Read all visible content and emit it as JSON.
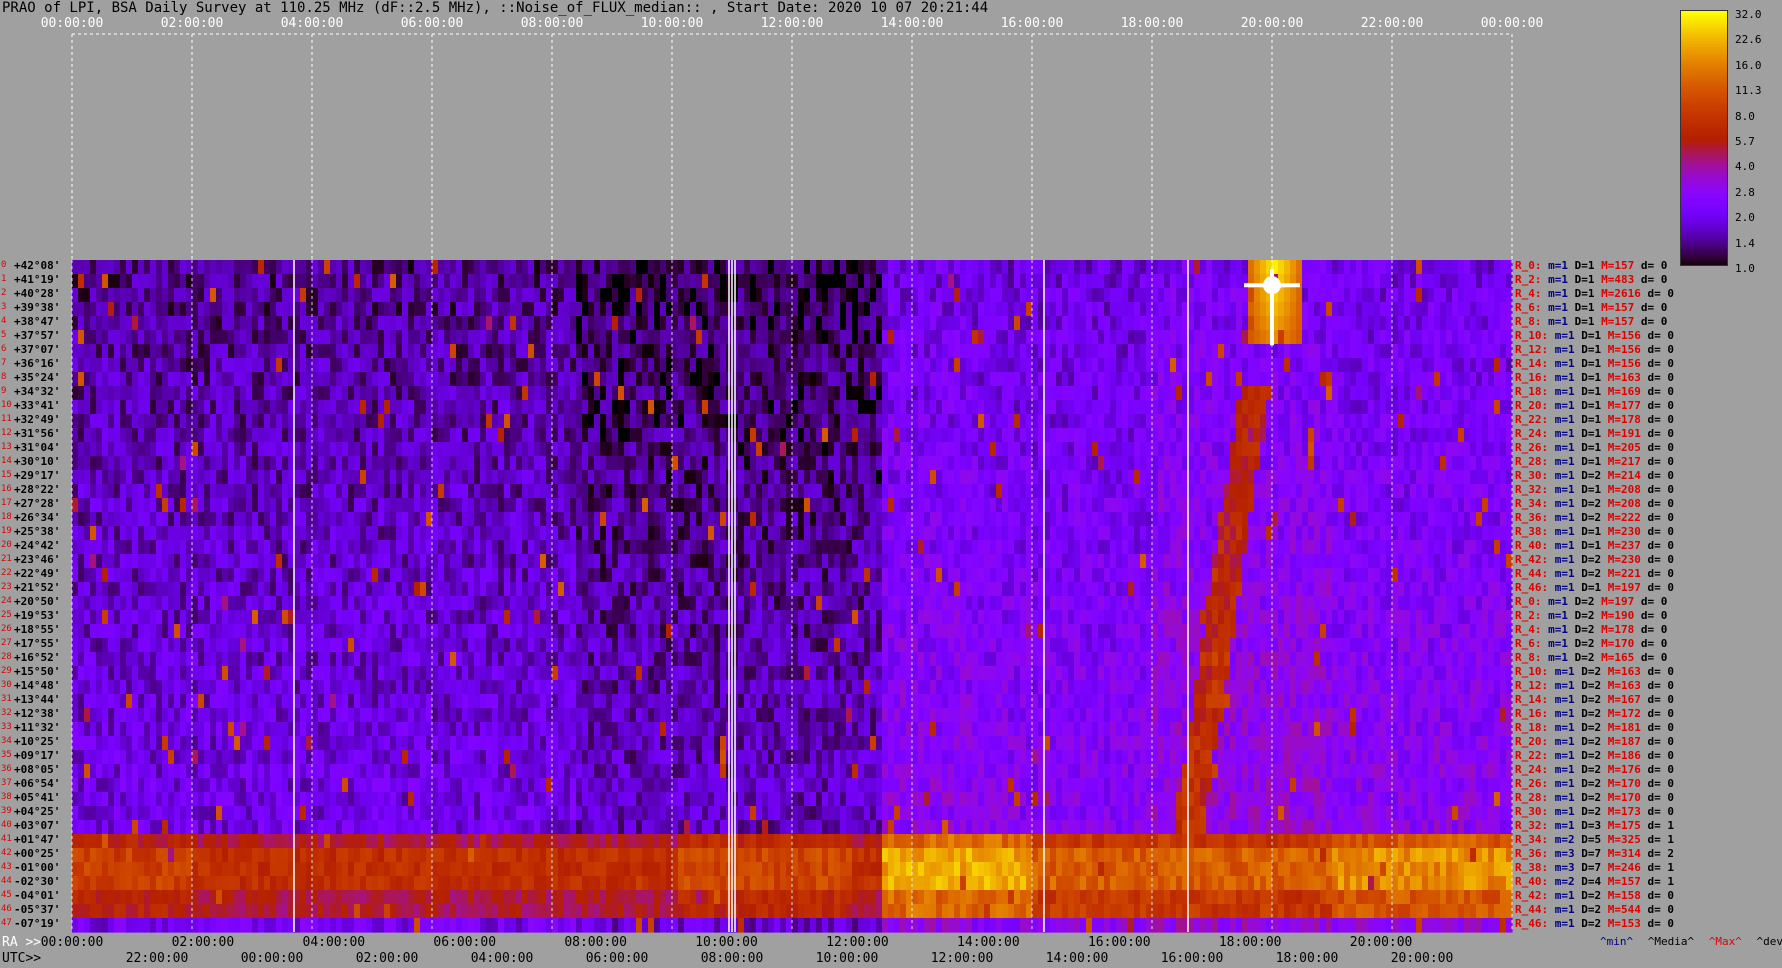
{
  "header": {
    "title": "PRAO of LPI, BSA Daily Survey at 110.25 MHz (dF::2.5 MHz), ::Noise_of_FLUX_median:: , Start Date: 2020 10 07 20:21:44"
  },
  "top_axis": {
    "ticks": [
      "00:00:00",
      "02:00:00",
      "04:00:00",
      "06:00:00",
      "08:00:00",
      "10:00:00",
      "12:00:00",
      "14:00:00",
      "16:00:00",
      "18:00:00",
      "20:00:00",
      "22:00:00",
      "00:00:00"
    ]
  },
  "bottom_axis": {
    "ra_prefix": "RA >>",
    "utc_prefix": "UTC>>",
    "ra_ticks": [
      "00:00:00",
      "02:00:00",
      "04:00:00",
      "06:00:00",
      "08:00:00",
      "10:00:00",
      "12:00:00",
      "14:00:00",
      "16:00:00",
      "18:00:00",
      "20:00:00"
    ],
    "utc_ticks": [
      "22:00:00",
      "00:00:00",
      "02:00:00",
      "04:00:00",
      "06:00:00",
      "08:00:00",
      "10:00:00",
      "12:00:00",
      "14:00:00",
      "16:00:00",
      "18:00:00",
      "20:00:00"
    ]
  },
  "legend": {
    "min_label": "^min^",
    "median_label": "^Media^",
    "max_label": "^Max^",
    "dev_label": "^devia^",
    "colors": {
      "min": "#000080",
      "median": "#000000",
      "max": "#e00000",
      "dev": "#000000"
    }
  },
  "colorbar": {
    "ticks": [
      "32.0",
      "22.6",
      "16.0",
      "11.3",
      "8.0",
      "5.7",
      "4.0",
      "2.8",
      "2.0",
      "1.4",
      "1.0"
    ]
  },
  "chart_data": {
    "type": "heatmap",
    "title": "PRAO of LPI, BSA Daily Survey at 110.25 MHz (dF::2.5 MHz), ::Noise_of_FLUX_median:: , Start Date: 2020 10 07 20:21:44",
    "xlabel": "RA / UTC",
    "ylabel": "",
    "x_range_hours": [
      0,
      24
    ],
    "scale": "log",
    "colorbar_range": [
      1.0,
      32.0
    ],
    "declinations": [
      "+42°08'",
      "+41°19'",
      "+40°28'",
      "+39°38'",
      "+38°47'",
      "+37°57'",
      "+37°07'",
      "+36°16'",
      "+35°24'",
      "+34°32'",
      "+33°41'",
      "+32°49'",
      "+31°56'",
      "+31°04'",
      "+30°10'",
      "+29°17'",
      "+28°22'",
      "+27°28'",
      "+26°34'",
      "+25°38'",
      "+24°42'",
      "+23°46'",
      "+22°49'",
      "+21°52'",
      "+20°50'",
      "+19°53'",
      "+18°55'",
      "+17°55'",
      "+16°52'",
      "+15°50'",
      "+14°48'",
      "+13°44'",
      "+12°38'",
      "+11°32'",
      "+10°25'",
      "+09°17'",
      "+08°05'",
      "+06°54'",
      "+05°41'",
      "+04°25'",
      "+03°07'",
      "+01°47'",
      "+00°25'",
      "-01°00'",
      "-02°30'",
      "-04°01'",
      "-05°37'",
      "-07°19'"
    ],
    "row_indices": [
      "0",
      "1",
      "2",
      "3",
      "4",
      "5",
      "6",
      "7",
      "8",
      "9",
      "10",
      "11",
      "12",
      "13",
      "14",
      "15",
      "16",
      "17",
      "18",
      "19",
      "20",
      "21",
      "22",
      "23",
      "24",
      "25",
      "26",
      "27",
      "28",
      "29",
      "30",
      "31",
      "32",
      "33",
      "34",
      "35",
      "36",
      "37",
      "38",
      "39",
      "40",
      "41",
      "42",
      "43",
      "44",
      "45",
      "46",
      "47"
    ],
    "rows": [
      {
        "r": "R_0:",
        "min": "m=1",
        "med": "D=1",
        "max": "M=157",
        "dev": "d= 0"
      },
      {
        "r": "R_2:",
        "min": "m=1",
        "med": "D=1",
        "max": "M=483",
        "dev": "d= 0"
      },
      {
        "r": "R_4:",
        "min": "m=1",
        "med": "D=1",
        "max": "M=2616",
        "dev": "d= 0"
      },
      {
        "r": "R_6:",
        "min": "m=1",
        "med": "D=1",
        "max": "M=157",
        "dev": "d= 0"
      },
      {
        "r": "R_8:",
        "min": "m=1",
        "med": "D=1",
        "max": "M=157",
        "dev": "d= 0"
      },
      {
        "r": "R_10:",
        "min": "m=1",
        "med": "D=1",
        "max": "M=156",
        "dev": "d= 0"
      },
      {
        "r": "R_12:",
        "min": "m=1",
        "med": "D=1",
        "max": "M=156",
        "dev": "d= 0"
      },
      {
        "r": "R_14:",
        "min": "m=1",
        "med": "D=1",
        "max": "M=156",
        "dev": "d= 0"
      },
      {
        "r": "R_16:",
        "min": "m=1",
        "med": "D=1",
        "max": "M=163",
        "dev": "d= 0"
      },
      {
        "r": "R_18:",
        "min": "m=1",
        "med": "D=1",
        "max": "M=169",
        "dev": "d= 0"
      },
      {
        "r": "R_20:",
        "min": "m=1",
        "med": "D=1",
        "max": "M=177",
        "dev": "d= 0"
      },
      {
        "r": "R_22:",
        "min": "m=1",
        "med": "D=1",
        "max": "M=178",
        "dev": "d= 0"
      },
      {
        "r": "R_24:",
        "min": "m=1",
        "med": "D=1",
        "max": "M=191",
        "dev": "d= 0"
      },
      {
        "r": "R_26:",
        "min": "m=1",
        "med": "D=1",
        "max": "M=205",
        "dev": "d= 0"
      },
      {
        "r": "R_28:",
        "min": "m=1",
        "med": "D=1",
        "max": "M=217",
        "dev": "d= 0"
      },
      {
        "r": "R_30:",
        "min": "m=1",
        "med": "D=2",
        "max": "M=214",
        "dev": "d= 0"
      },
      {
        "r": "R_32:",
        "min": "m=1",
        "med": "D=1",
        "max": "M=208",
        "dev": "d= 0"
      },
      {
        "r": "R_34:",
        "min": "m=1",
        "med": "D=2",
        "max": "M=208",
        "dev": "d= 0"
      },
      {
        "r": "R_36:",
        "min": "m=1",
        "med": "D=2",
        "max": "M=222",
        "dev": "d= 0"
      },
      {
        "r": "R_38:",
        "min": "m=1",
        "med": "D=1",
        "max": "M=230",
        "dev": "d= 0"
      },
      {
        "r": "R_40:",
        "min": "m=1",
        "med": "D=1",
        "max": "M=237",
        "dev": "d= 0"
      },
      {
        "r": "R_42:",
        "min": "m=1",
        "med": "D=2",
        "max": "M=230",
        "dev": "d= 0"
      },
      {
        "r": "R_44:",
        "min": "m=1",
        "med": "D=2",
        "max": "M=221",
        "dev": "d= 0"
      },
      {
        "r": "R_46:",
        "min": "m=1",
        "med": "D=1",
        "max": "M=197",
        "dev": "d= 0"
      },
      {
        "r": "R_0:",
        "min": "m=1",
        "med": "D=2",
        "max": "M=197",
        "dev": "d= 0"
      },
      {
        "r": "R_2:",
        "min": "m=1",
        "med": "D=2",
        "max": "M=190",
        "dev": "d= 0"
      },
      {
        "r": "R_4:",
        "min": "m=1",
        "med": "D=2",
        "max": "M=178",
        "dev": "d= 0"
      },
      {
        "r": "R_6:",
        "min": "m=1",
        "med": "D=2",
        "max": "M=170",
        "dev": "d= 0"
      },
      {
        "r": "R_8:",
        "min": "m=1",
        "med": "D=2",
        "max": "M=165",
        "dev": "d= 0"
      },
      {
        "r": "R_10:",
        "min": "m=1",
        "med": "D=2",
        "max": "M=163",
        "dev": "d= 0"
      },
      {
        "r": "R_12:",
        "min": "m=1",
        "med": "D=2",
        "max": "M=163",
        "dev": "d= 0"
      },
      {
        "r": "R_14:",
        "min": "m=1",
        "med": "D=2",
        "max": "M=167",
        "dev": "d= 0"
      },
      {
        "r": "R_16:",
        "min": "m=1",
        "med": "D=2",
        "max": "M=172",
        "dev": "d= 0"
      },
      {
        "r": "R_18:",
        "min": "m=1",
        "med": "D=2",
        "max": "M=181",
        "dev": "d= 0"
      },
      {
        "r": "R_20:",
        "min": "m=1",
        "med": "D=2",
        "max": "M=187",
        "dev": "d= 0"
      },
      {
        "r": "R_22:",
        "min": "m=1",
        "med": "D=2",
        "max": "M=186",
        "dev": "d= 0"
      },
      {
        "r": "R_24:",
        "min": "m=1",
        "med": "D=2",
        "max": "M=176",
        "dev": "d= 0"
      },
      {
        "r": "R_26:",
        "min": "m=1",
        "med": "D=2",
        "max": "M=170",
        "dev": "d= 0"
      },
      {
        "r": "R_28:",
        "min": "m=1",
        "med": "D=2",
        "max": "M=170",
        "dev": "d= 0"
      },
      {
        "r": "R_30:",
        "min": "m=1",
        "med": "D=2",
        "max": "M=173",
        "dev": "d= 0"
      },
      {
        "r": "R_32:",
        "min": "m=1",
        "med": "D=3",
        "max": "M=175",
        "dev": "d= 1"
      },
      {
        "r": "R_34:",
        "min": "m=2",
        "med": "D=5",
        "max": "M=325",
        "dev": "d= 1"
      },
      {
        "r": "R_36:",
        "min": "m=3",
        "med": "D=7",
        "max": "M=314",
        "dev": "d= 2"
      },
      {
        "r": "R_38:",
        "min": "m=3",
        "med": "D=7",
        "max": "M=246",
        "dev": "d= 1"
      },
      {
        "r": "R_40:",
        "min": "m=2",
        "med": "D=4",
        "max": "M=157",
        "dev": "d= 1"
      },
      {
        "r": "R_42:",
        "min": "m=1",
        "med": "D=2",
        "max": "M=158",
        "dev": "d= 0"
      },
      {
        "r": "R_44:",
        "min": "m=1",
        "med": "D=2",
        "max": "M=544",
        "dev": "d= 0"
      },
      {
        "r": "R_46:",
        "min": "m=1",
        "med": "D=2",
        "max": "M=153",
        "dev": "d= 0"
      }
    ],
    "features": {
      "bright_band_rows": [
        41,
        47
      ],
      "bright_source_ra_hours": 20.0,
      "bright_source_row": 2
    }
  }
}
